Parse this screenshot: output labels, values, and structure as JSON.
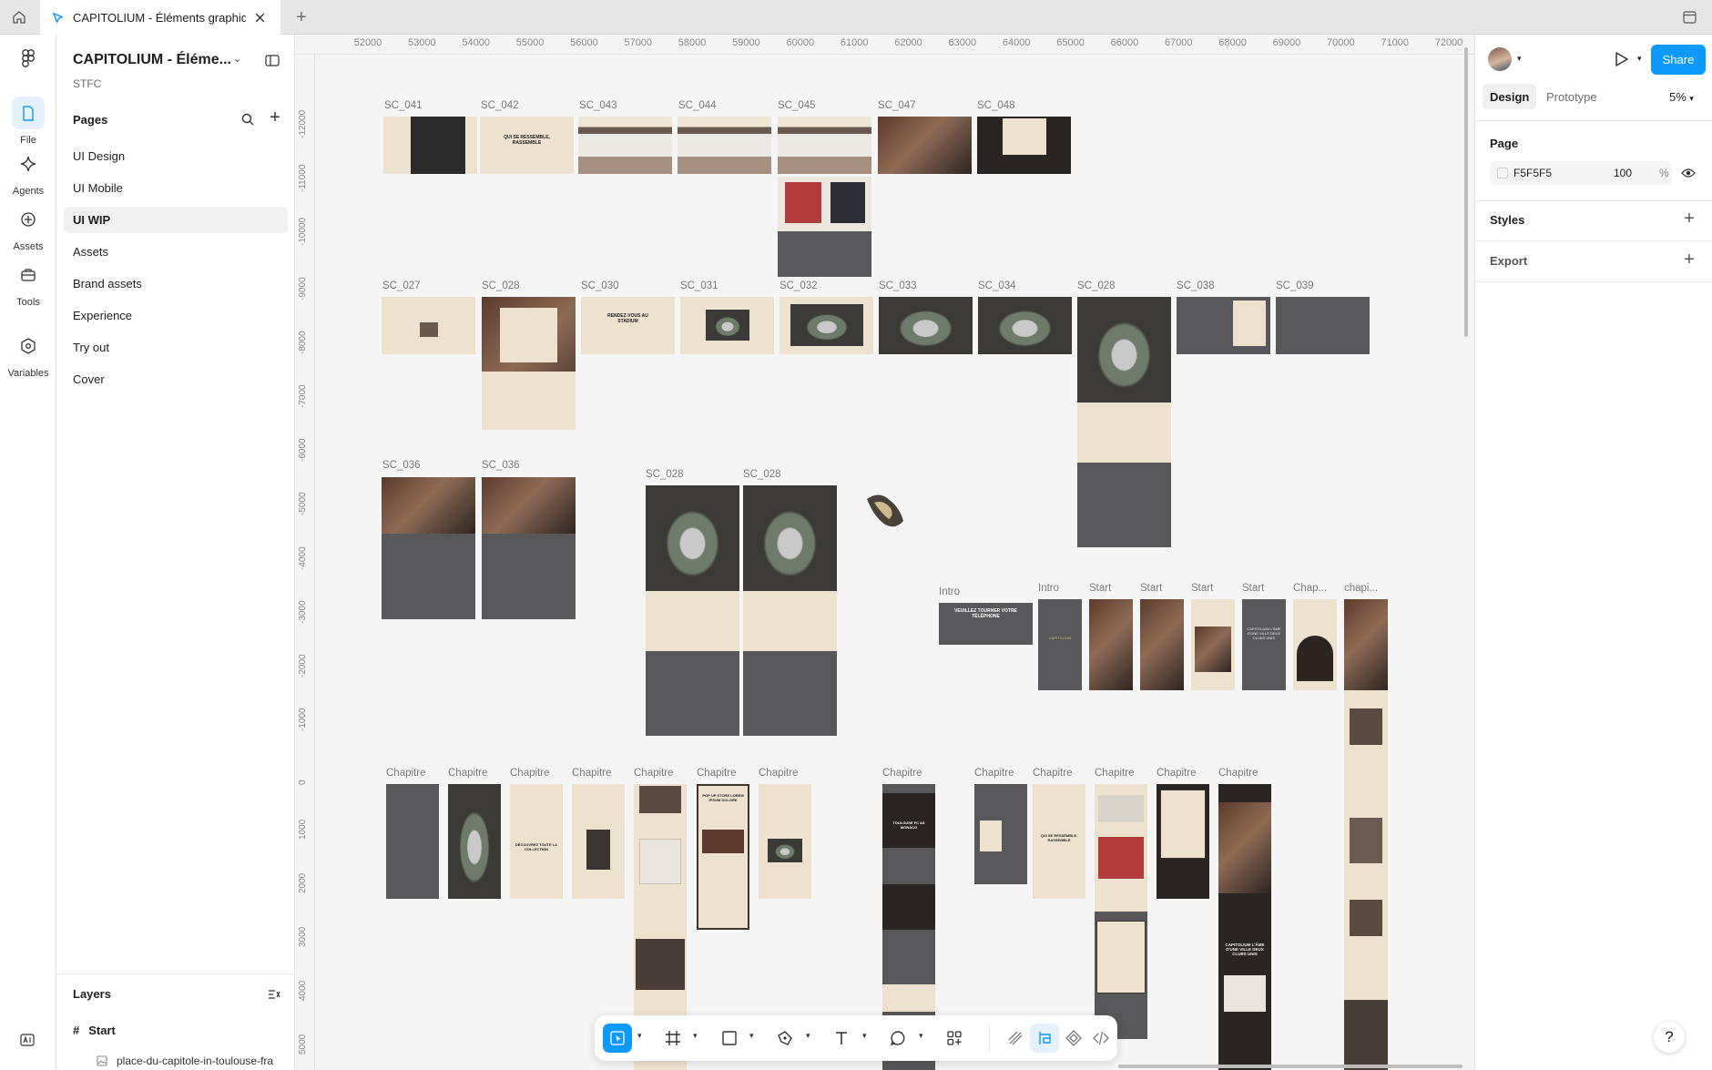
{
  "tabbar": {
    "active_tab_title": "CAPITOLIUM - Éléments graphiq",
    "icons": [
      "home-icon",
      "figma-file-icon",
      "close-icon",
      "plus-icon",
      "panel-icon"
    ]
  },
  "rail": {
    "items": [
      {
        "label": "File",
        "icon": "file-icon",
        "active": true
      },
      {
        "label": "Agents",
        "icon": "sparkle-icon"
      },
      {
        "label": "Assets",
        "icon": "assets-icon"
      },
      {
        "label": "Tools",
        "icon": "toolbox-icon"
      },
      {
        "label": "Variables",
        "icon": "variables-icon"
      }
    ]
  },
  "file": {
    "name": "CAPITOLIUM - Éléme...",
    "team": "STFC"
  },
  "pages": {
    "heading": "Pages",
    "items": [
      "UI Design",
      "UI Mobile",
      "UI WIP",
      "Assets",
      "Brand assets",
      "Experience",
      "Try out",
      "Cover"
    ],
    "active": "UI WIP"
  },
  "layers": {
    "heading": "Layers",
    "items": [
      {
        "name": "Start",
        "icon": "frame-hash-icon"
      },
      {
        "name": "place-du-capitole-in-toulouse-fra",
        "icon": "image-icon"
      }
    ]
  },
  "ruler": {
    "top": [
      "52000",
      "53000",
      "54000",
      "55000",
      "56000",
      "57000",
      "58000",
      "59000",
      "60000",
      "61000",
      "62000",
      "63000",
      "64000",
      "65000",
      "66000",
      "67000",
      "68000",
      "69000",
      "70000",
      "71000",
      "72000"
    ],
    "left": [
      "-12000",
      "-11000",
      "-10000",
      "-9000",
      "-8000",
      "-7000",
      "-6000",
      "-5000",
      "-4000",
      "-3000",
      "-2000",
      "-1000",
      "0",
      "1000",
      "2000",
      "3000",
      "4000",
      "5000"
    ]
  },
  "frames": [
    "SC_041",
    "SC_042",
    "SC_043",
    "SC_044",
    "SC_045",
    "SC_047",
    "SC_048",
    "SC_027",
    "SC_028",
    "SC_030",
    "SC_031",
    "SC_032",
    "SC_033",
    "SC_034",
    "SC_028",
    "SC_038",
    "SC_039",
    "SC_036",
    "SC_036",
    "SC_028",
    "SC_028",
    "Intro",
    "Intro",
    "Start",
    "Start",
    "Start",
    "Start",
    "Chap...",
    "chapi...",
    "Chapitre",
    "Chapitre",
    "Chapitre",
    "Chapitre",
    "Chapitre",
    "Chapitre",
    "Chapitre",
    "Chapitre",
    "Chapitre",
    "Chapitre",
    "Chapitre",
    "Chapitre",
    "Chapitre"
  ],
  "thumb_text": {
    "qui_se_ressemble": "QUI SE RESSEMBLE, RASSEMBLE",
    "rendez_vous": "RENDEZ-VOUS AU STADIUM",
    "veuillez": "VEUILLEZ TOURNER VOTRE TÉLÉPHONE",
    "capitolium": "CAPITOLIUM",
    "ame": "CAPITOLIUM L'ÂME D'UNE VILLE DEUX CLUBS UNIS",
    "decouvrez": "DÉCOUVREZ TOUTE LA COLLECTION",
    "popup": "POP UP STORE LOREM IPSUM DOLORE",
    "toulouse": "TOULOUSE FC AS MONACO"
  },
  "toolbar": {
    "tools": [
      "move-icon",
      "frame-icon",
      "rectangle-icon",
      "pen-icon",
      "text-icon",
      "comment-icon",
      "actions-icon",
      "draw-icon",
      "design-mode-icon",
      "component-icon",
      "dev-mode-icon"
    ]
  },
  "rightpanel": {
    "share_label": "Share",
    "tabs": [
      "Design",
      "Prototype"
    ],
    "active_tab": "Design",
    "zoom": "5%",
    "page_heading": "Page",
    "fill_hex": "F5F5F5",
    "fill_opacity": "100",
    "fill_pct": "%",
    "styles_heading": "Styles",
    "export_heading": "Export"
  },
  "colors": {
    "accent": "#0d99ff",
    "canvas_bg": "#F5F5F5",
    "cream": "#eee2cf",
    "dark": "#2a2522"
  }
}
